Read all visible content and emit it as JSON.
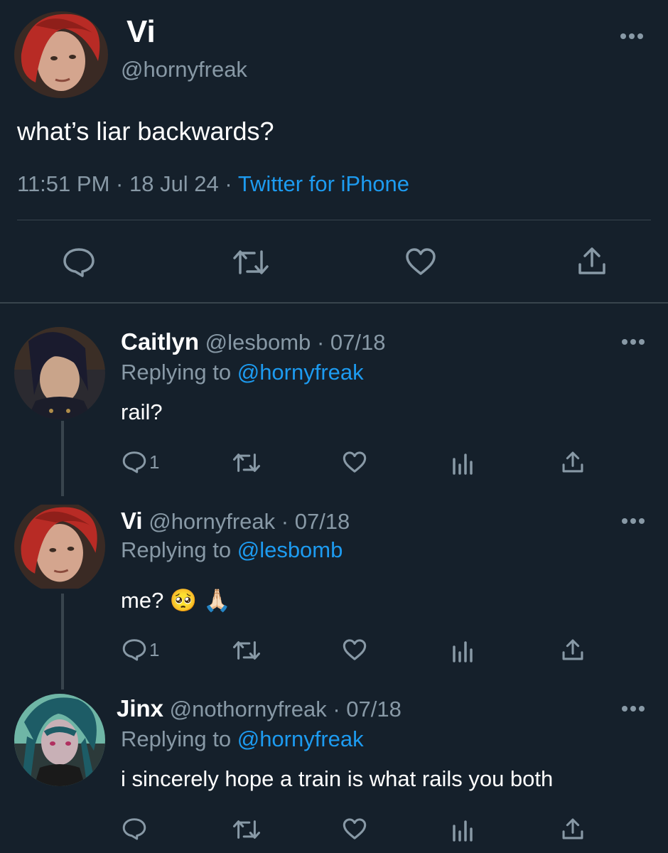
{
  "main_tweet": {
    "author_name": "Vi",
    "author_handle": "@hornyfreak",
    "text": "what’s liar backwards?",
    "time": "11:51 PM",
    "date": "18 Jul 24",
    "separator": "·",
    "source": "Twitter for iPhone"
  },
  "replies": [
    {
      "name": "Caitlyn",
      "handle": "@lesbomb",
      "date_sep": "· 07/18",
      "replying_prefix": "Replying to",
      "replying_to": "@hornyfreak",
      "text": "rail?",
      "reply_count": "1",
      "avatar_colors": [
        "#2a2d3a",
        "#1a1c26",
        "#c9a48a"
      ]
    },
    {
      "name": "Vi",
      "handle": "@hornyfreak",
      "date_sep": "· 07/18",
      "replying_prefix": "Replying to",
      "replying_to": "@lesbomb",
      "text": "me? 🥺 🙏🏻",
      "reply_count": "1",
      "avatar_colors": [
        "#8f2a22",
        "#c0392b",
        "#d9a890"
      ]
    },
    {
      "name": "Jinx",
      "handle": "@nothornyfreak",
      "date_sep": "· 07/18",
      "replying_prefix": "Replying to",
      "replying_to": "@hornyfreak",
      "text": "i sincerely hope a train is what rails you both",
      "reply_count": "",
      "avatar_colors": [
        "#3b8c8a",
        "#1f4e4c",
        "#c6b2b8"
      ]
    }
  ],
  "icons": {
    "reply": "speech-bubble-icon",
    "retweet": "retweet-icon",
    "like": "heart-icon",
    "analytics": "bar-chart-icon",
    "share": "share-icon",
    "more": "more-dots-icon"
  },
  "colors": {
    "background": "#15202b",
    "text": "#ffffff",
    "muted": "#8899a6",
    "accent": "#1d9bf0",
    "divider": "#38444d"
  }
}
